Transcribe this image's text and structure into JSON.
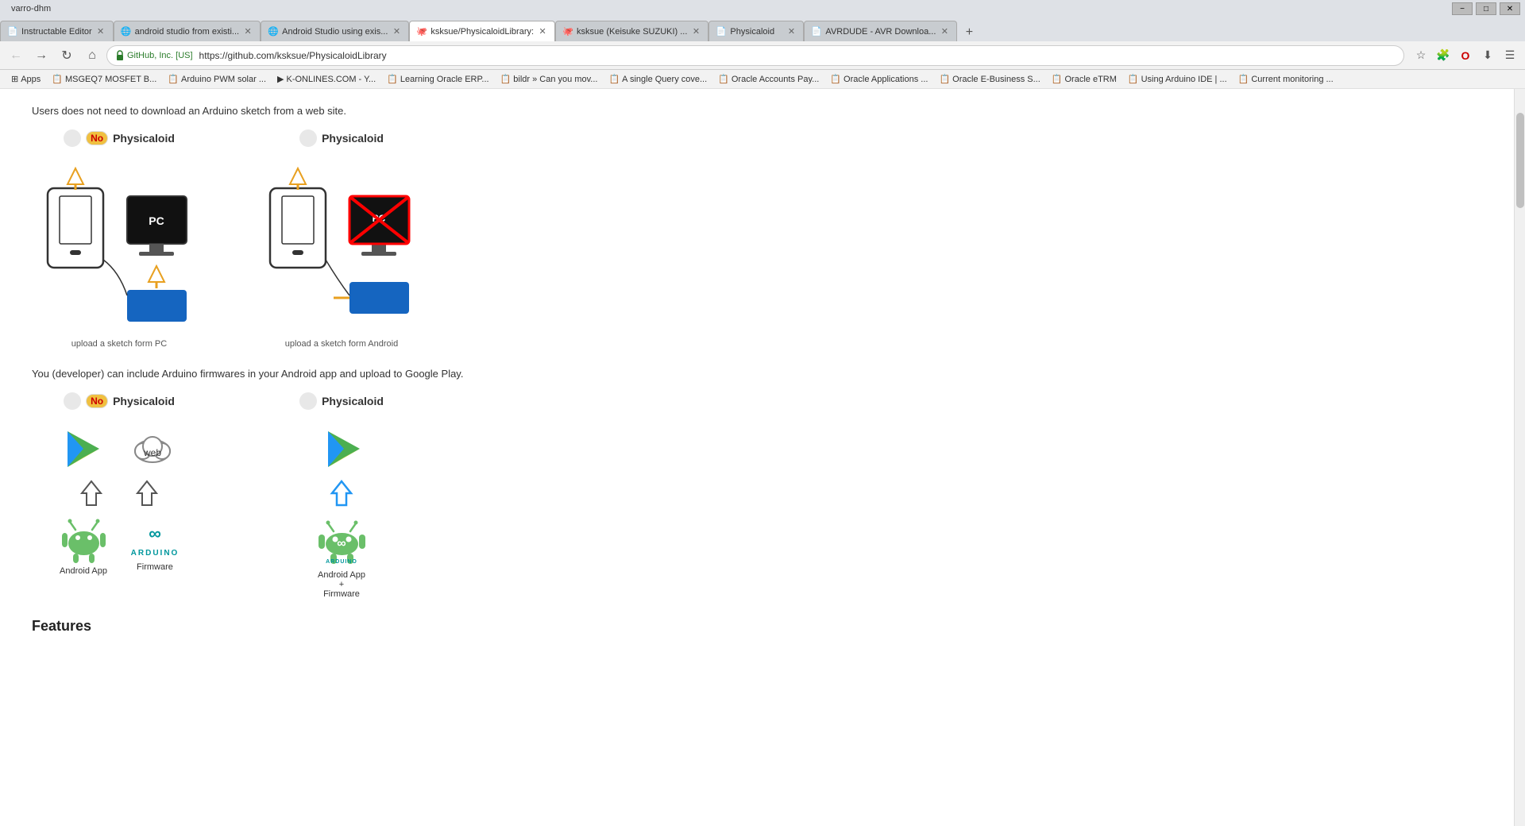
{
  "browser": {
    "title": "varro-dhm",
    "titlebar": {
      "minimize": "−",
      "restore": "□",
      "close": "✕"
    },
    "tabs": [
      {
        "id": "tab1",
        "label": "Instructable Editor",
        "favicon": "📄",
        "active": false
      },
      {
        "id": "tab2",
        "label": "android studio from existi...",
        "favicon": "🌐",
        "active": false
      },
      {
        "id": "tab3",
        "label": "Android Studio using exis...",
        "favicon": "🌐",
        "active": false
      },
      {
        "id": "tab4",
        "label": "ksksue/PhysicaloidLibrary:",
        "favicon": "🐙",
        "active": true
      },
      {
        "id": "tab5",
        "label": "ksksue (Keisuke SUZUKI) ...",
        "favicon": "🐙",
        "active": false
      },
      {
        "id": "tab6",
        "label": "Physicaloid",
        "favicon": "📄",
        "active": false
      },
      {
        "id": "tab7",
        "label": "AVRDUDE - AVR Downloa...",
        "favicon": "📄",
        "active": false
      }
    ],
    "address": {
      "security_label": "GitHub, Inc. [US]",
      "url": "https://github.com/ksksue/PhysicaloidLibrary",
      "url_highlight": "https://github.com/ksksue/PhysicaloidLibrary"
    }
  },
  "bookmarks": [
    {
      "label": "Apps",
      "icon": "⊞"
    },
    {
      "label": "MSGEQ7 MOSFET B...",
      "icon": "📋"
    },
    {
      "label": "Arduino PWM solar ...",
      "icon": "📋"
    },
    {
      "label": "K-ONLINES.COM - Y...",
      "icon": "▶"
    },
    {
      "label": "Learning Oracle ERP...",
      "icon": "📋"
    },
    {
      "label": "bildr » Can you mov...",
      "icon": "📋"
    },
    {
      "label": "A single Query cove...",
      "icon": "📋"
    },
    {
      "label": "Oracle Accounts Pay...",
      "icon": "📋"
    },
    {
      "label": "Oracle Applications ...",
      "icon": "📋"
    },
    {
      "label": "Oracle E-Business S...",
      "icon": "📋"
    },
    {
      "label": "Oracle eTRM",
      "icon": "📋"
    },
    {
      "label": "Using Arduino IDE | ...",
      "icon": "📋"
    },
    {
      "label": "Current monitoring ...",
      "icon": "📋"
    }
  ],
  "page": {
    "intro1": "Users does not need to download an Arduino sketch from a web site.",
    "section1": {
      "left_title": "No  Physicaloid",
      "left_no": "No",
      "left_caption": "upload a sketch form PC",
      "right_title": "Physicaloid",
      "right_caption": "upload a sketch form Android"
    },
    "intro2": "You (developer) can include Arduino firmwares in your Android app and upload to Google Play.",
    "section2": {
      "left_title": "No  Physicaloid",
      "left_no": "No",
      "left_items": [
        "Android App",
        "Firmware"
      ],
      "right_title": "Physicaloid",
      "right_items": [
        "Android App\n+\nFirmware"
      ]
    },
    "features_heading": "Features"
  }
}
